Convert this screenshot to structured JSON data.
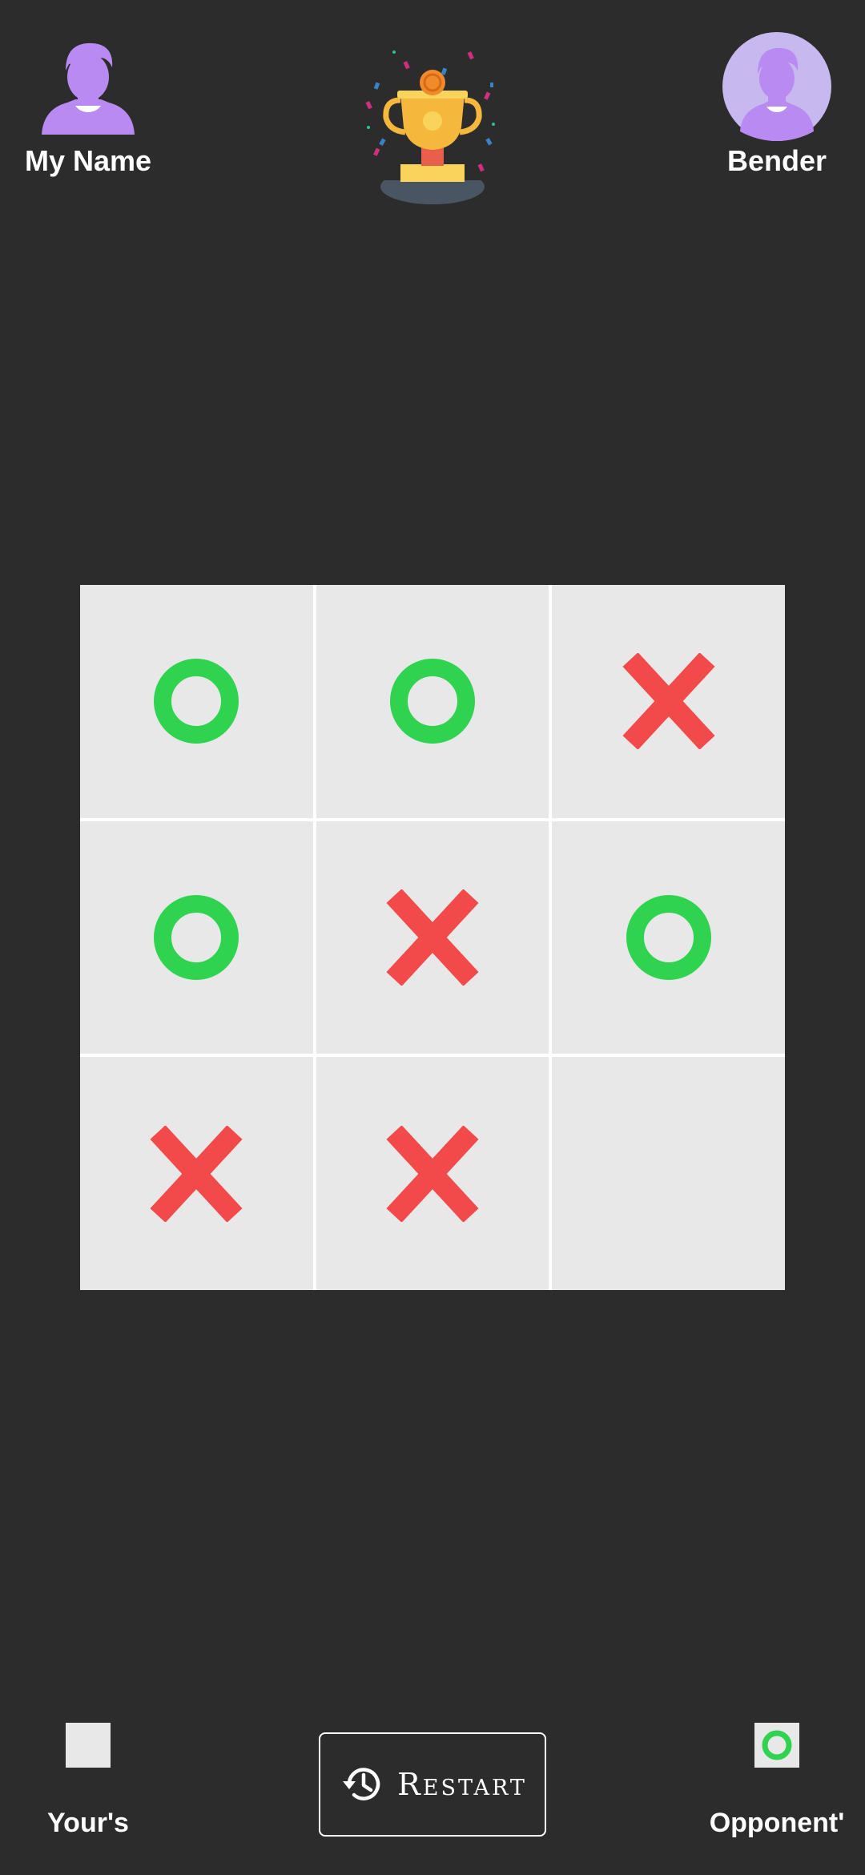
{
  "header": {
    "player_left_name": "My Name",
    "player_right_name": "Bender"
  },
  "board": {
    "cells": [
      "O",
      "O",
      "X",
      "O",
      "X",
      "O",
      "X",
      "X",
      ""
    ]
  },
  "footer": {
    "yours_label": "Your's",
    "opponent_label": "Opponent'",
    "restart_label": "Restart"
  },
  "colors": {
    "background": "#2c2c2c",
    "cell": "#e8e8e8",
    "o_mark": "#2fd34f",
    "x_mark": "#f24a4a",
    "avatar": "#b98af2"
  },
  "icons": {
    "left_avatar": "user-avatar-icon",
    "right_avatar": "user-avatar-icon",
    "trophy": "trophy-icon",
    "restart": "history-icon"
  }
}
